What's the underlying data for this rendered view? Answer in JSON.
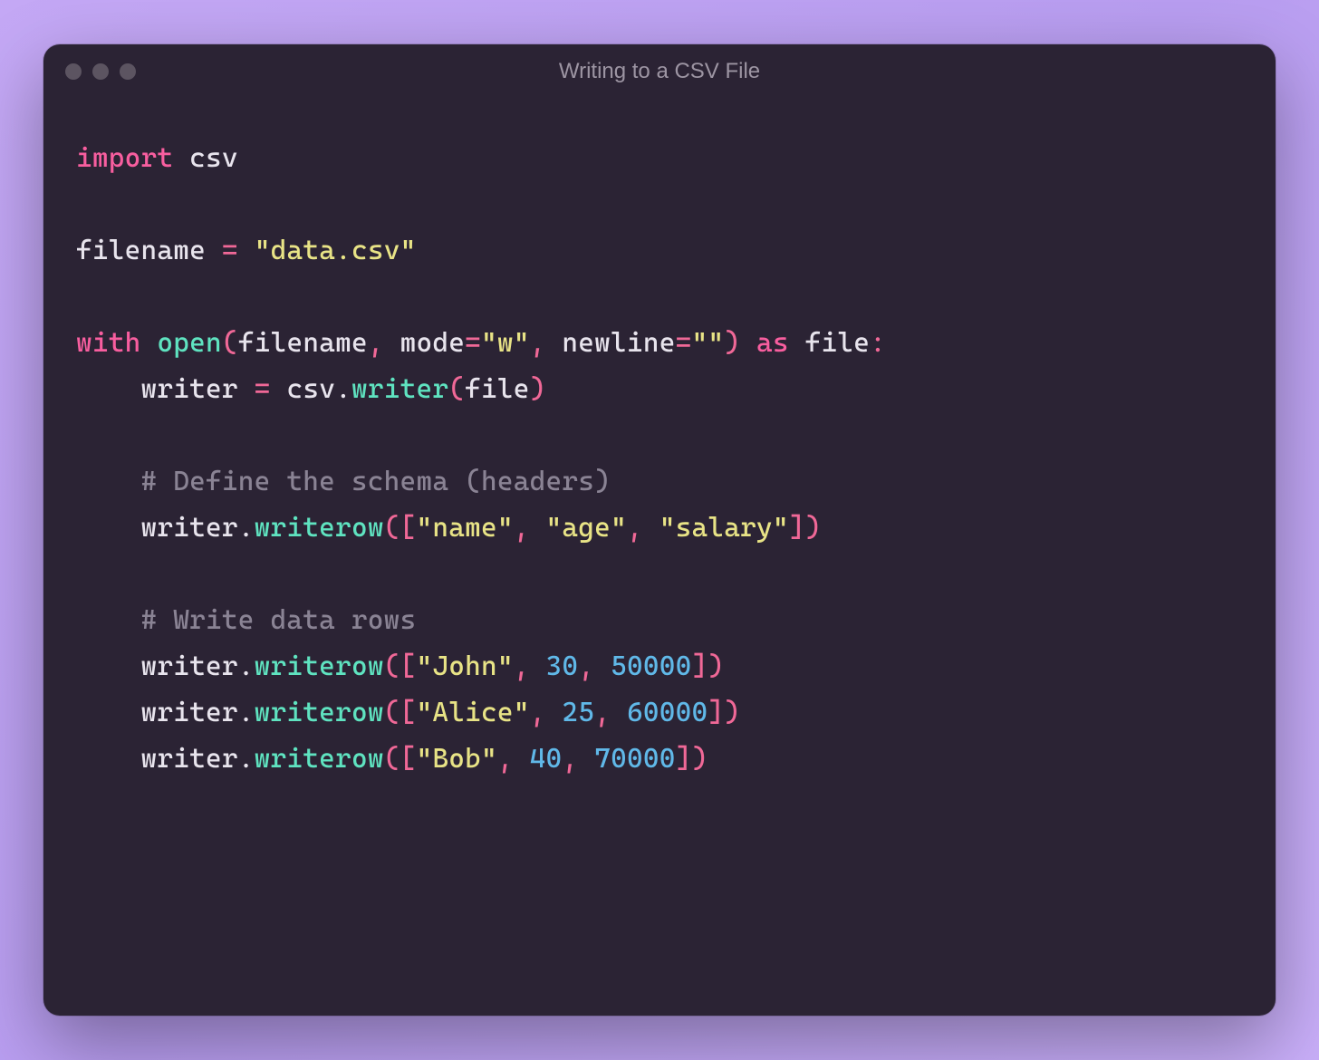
{
  "window": {
    "title": "Writing to a CSV File"
  },
  "code": {
    "lines": [
      {
        "tokens": [
          {
            "t": "import",
            "c": "kw"
          },
          {
            "t": " ",
            "c": "id"
          },
          {
            "t": "csv",
            "c": "id"
          }
        ]
      },
      {
        "tokens": []
      },
      {
        "tokens": [
          {
            "t": "filename ",
            "c": "id"
          },
          {
            "t": "=",
            "c": "punc"
          },
          {
            "t": " ",
            "c": "id"
          },
          {
            "t": "\"data.csv\"",
            "c": "str"
          }
        ]
      },
      {
        "tokens": []
      },
      {
        "tokens": [
          {
            "t": "with",
            "c": "kw"
          },
          {
            "t": " ",
            "c": "id"
          },
          {
            "t": "open",
            "c": "fn"
          },
          {
            "t": "(",
            "c": "punc"
          },
          {
            "t": "filename",
            "c": "id"
          },
          {
            "t": ",",
            "c": "punc"
          },
          {
            "t": " mode",
            "c": "id"
          },
          {
            "t": "=",
            "c": "punc"
          },
          {
            "t": "\"w\"",
            "c": "str"
          },
          {
            "t": ",",
            "c": "punc"
          },
          {
            "t": " newline",
            "c": "id"
          },
          {
            "t": "=",
            "c": "punc"
          },
          {
            "t": "\"\"",
            "c": "str"
          },
          {
            "t": ")",
            "c": "punc"
          },
          {
            "t": " ",
            "c": "id"
          },
          {
            "t": "as",
            "c": "kw"
          },
          {
            "t": " file",
            "c": "id"
          },
          {
            "t": ":",
            "c": "punc"
          }
        ]
      },
      {
        "tokens": [
          {
            "t": "    writer ",
            "c": "id"
          },
          {
            "t": "=",
            "c": "punc"
          },
          {
            "t": " csv",
            "c": "id"
          },
          {
            "t": ".",
            "c": "dot"
          },
          {
            "t": "writer",
            "c": "fn"
          },
          {
            "t": "(",
            "c": "punc"
          },
          {
            "t": "file",
            "c": "id"
          },
          {
            "t": ")",
            "c": "punc"
          }
        ]
      },
      {
        "tokens": []
      },
      {
        "tokens": [
          {
            "t": "    # Define the schema (headers)",
            "c": "com"
          }
        ]
      },
      {
        "tokens": [
          {
            "t": "    writer",
            "c": "id"
          },
          {
            "t": ".",
            "c": "dot"
          },
          {
            "t": "writerow",
            "c": "fn"
          },
          {
            "t": "([",
            "c": "punc"
          },
          {
            "t": "\"name\"",
            "c": "str"
          },
          {
            "t": ",",
            "c": "punc"
          },
          {
            "t": " ",
            "c": "id"
          },
          {
            "t": "\"age\"",
            "c": "str"
          },
          {
            "t": ",",
            "c": "punc"
          },
          {
            "t": " ",
            "c": "id"
          },
          {
            "t": "\"salary\"",
            "c": "str"
          },
          {
            "t": "])",
            "c": "punc"
          }
        ]
      },
      {
        "tokens": []
      },
      {
        "tokens": [
          {
            "t": "    # Write data rows",
            "c": "com"
          }
        ]
      },
      {
        "tokens": [
          {
            "t": "    writer",
            "c": "id"
          },
          {
            "t": ".",
            "c": "dot"
          },
          {
            "t": "writerow",
            "c": "fn"
          },
          {
            "t": "([",
            "c": "punc"
          },
          {
            "t": "\"John\"",
            "c": "str"
          },
          {
            "t": ",",
            "c": "punc"
          },
          {
            "t": " ",
            "c": "id"
          },
          {
            "t": "30",
            "c": "num"
          },
          {
            "t": ",",
            "c": "punc"
          },
          {
            "t": " ",
            "c": "id"
          },
          {
            "t": "50000",
            "c": "num"
          },
          {
            "t": "])",
            "c": "punc"
          }
        ]
      },
      {
        "tokens": [
          {
            "t": "    writer",
            "c": "id"
          },
          {
            "t": ".",
            "c": "dot"
          },
          {
            "t": "writerow",
            "c": "fn"
          },
          {
            "t": "([",
            "c": "punc"
          },
          {
            "t": "\"Alice\"",
            "c": "str"
          },
          {
            "t": ",",
            "c": "punc"
          },
          {
            "t": " ",
            "c": "id"
          },
          {
            "t": "25",
            "c": "num"
          },
          {
            "t": ",",
            "c": "punc"
          },
          {
            "t": " ",
            "c": "id"
          },
          {
            "t": "60000",
            "c": "num"
          },
          {
            "t": "])",
            "c": "punc"
          }
        ]
      },
      {
        "tokens": [
          {
            "t": "    writer",
            "c": "id"
          },
          {
            "t": ".",
            "c": "dot"
          },
          {
            "t": "writerow",
            "c": "fn"
          },
          {
            "t": "([",
            "c": "punc"
          },
          {
            "t": "\"Bob\"",
            "c": "str"
          },
          {
            "t": ",",
            "c": "punc"
          },
          {
            "t": " ",
            "c": "id"
          },
          {
            "t": "40",
            "c": "num"
          },
          {
            "t": ",",
            "c": "punc"
          },
          {
            "t": " ",
            "c": "id"
          },
          {
            "t": "70000",
            "c": "num"
          },
          {
            "t": "])",
            "c": "punc"
          }
        ]
      }
    ]
  }
}
